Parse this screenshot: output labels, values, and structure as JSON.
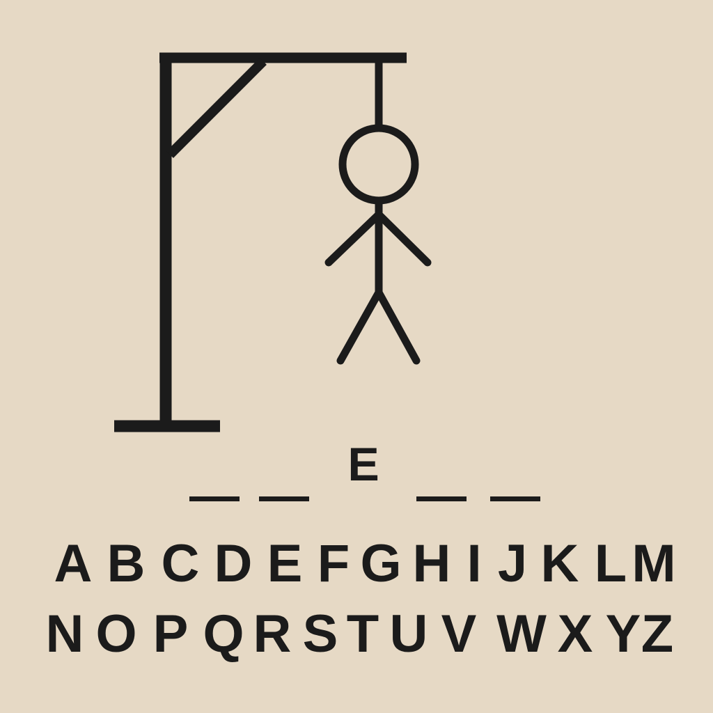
{
  "game": {
    "word_slots": [
      "",
      "",
      "",
      "E",
      "",
      ""
    ],
    "stroke_color": "#1b1b1b",
    "background_color": "#e6d9c5"
  },
  "keyboard": {
    "rows": [
      [
        "A",
        "B",
        "C",
        "D",
        "E",
        "F",
        "G",
        "H",
        "I",
        "J",
        "K",
        "L",
        "M"
      ],
      [
        "N",
        "O",
        "P",
        "Q",
        "R",
        "S",
        "T",
        "U",
        "V",
        "W",
        "X",
        "Y",
        "Z"
      ]
    ]
  }
}
